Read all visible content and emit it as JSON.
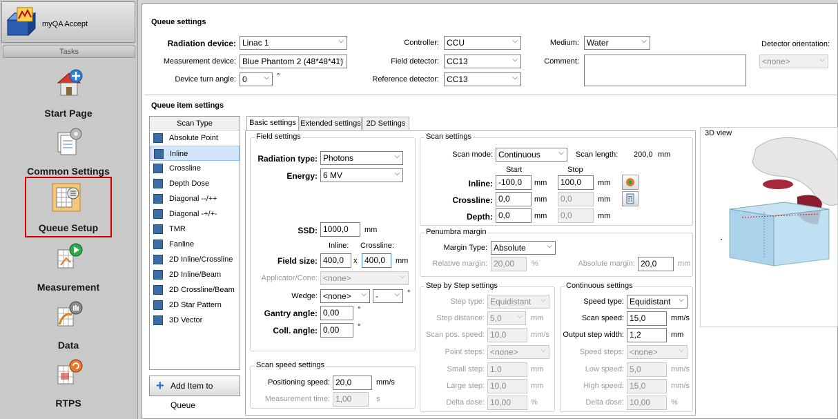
{
  "app": {
    "title": "myQA Accept",
    "tasks_label": "Tasks"
  },
  "nav": [
    {
      "label": "Start Page"
    },
    {
      "label": "Common Settings"
    },
    {
      "label": "Queue Setup"
    },
    {
      "label": "Measurement"
    },
    {
      "label": "Data"
    },
    {
      "label": "RTPS"
    }
  ],
  "queue_settings": {
    "title": "Queue settings",
    "radiation_device": {
      "label": "Radiation device:",
      "value": "Linac 1"
    },
    "measurement_device": {
      "label": "Measurement device:",
      "value": "Blue Phantom 2  (48*48*41)"
    },
    "device_turn_angle": {
      "label": "Device turn angle:",
      "value": "0",
      "unit": "°"
    },
    "controller": {
      "label": "Controller:",
      "value": "CCU"
    },
    "field_detector": {
      "label": "Field detector:",
      "value": "CC13"
    },
    "reference_detector": {
      "label": "Reference detector:",
      "value": "CC13"
    },
    "medium": {
      "label": "Medium:",
      "value": "Water"
    },
    "comment": {
      "label": "Comment:",
      "value": ""
    },
    "detector_orientation": {
      "label": "Detector orientation:",
      "value": "<none>"
    }
  },
  "queue_item": {
    "title": "Queue item settings",
    "scan_type_header": "Scan Type",
    "scan_types": [
      "Absolute Point",
      "Inline",
      "Crossline",
      "Depth Dose",
      "Diagonal --/++",
      "Diagonal -+/+-",
      "TMR",
      "Fanline",
      "2D Inline/Crossline",
      "2D Inline/Beam",
      "2D Crossline/Beam",
      "2D Star Pattern",
      "3D Vector"
    ],
    "selected_scan_type": "Inline",
    "add_button": "Add Item to Queue",
    "tabs": [
      "Basic settings",
      "Extended settings",
      "2D Settings"
    ]
  },
  "field_settings": {
    "title": "Field settings",
    "radiation_type": {
      "label": "Radiation type:",
      "value": "Photons"
    },
    "energy": {
      "label": "Energy:",
      "value": "6 MV"
    },
    "ssd": {
      "label": "SSD:",
      "value": "1000,0",
      "unit": "mm"
    },
    "field_size": {
      "label": "Field size:",
      "inline_label": "Inline:",
      "crossline_label": "Crossline:",
      "inline": "400,0",
      "x": "x",
      "crossline": "400,0",
      "unit": "mm"
    },
    "applicator": {
      "label": "Applicator/Cone:",
      "value": "<none>"
    },
    "wedge": {
      "label": "Wedge:",
      "value": "<none>",
      "angle": "-",
      "unit": "°"
    },
    "gantry_angle": {
      "label": "Gantry angle:",
      "value": "0,00",
      "unit": "°"
    },
    "coll_angle": {
      "label": "Coll. angle:",
      "value": "0,00",
      "unit": "°"
    }
  },
  "scan_speed_settings": {
    "title": "Scan speed settings",
    "positioning_speed": {
      "label": "Positioning speed:",
      "value": "20,0",
      "unit": "mm/s"
    },
    "measurement_time": {
      "label": "Measurement time:",
      "value": "1,00",
      "unit": "s"
    }
  },
  "scan_settings": {
    "title": "Scan settings",
    "scan_mode": {
      "label": "Scan mode:",
      "value": "Continuous"
    },
    "scan_length": {
      "label": "Scan length:",
      "value": "200,0",
      "unit": "mm"
    },
    "start_label": "Start",
    "stop_label": "Stop",
    "inline": {
      "label": "Inline:",
      "start": "-100,0",
      "stop": "100,0"
    },
    "crossline": {
      "label": "Crossline:",
      "start": "0,0",
      "stop": "0,0"
    },
    "depth": {
      "label": "Depth:",
      "start": "0,0",
      "stop": "0,0"
    },
    "unit": "mm"
  },
  "penumbra": {
    "title": "Penumbra margin",
    "margin_type": {
      "label": "Margin Type:",
      "value": "Absolute"
    },
    "relative_margin": {
      "label": "Relative margin:",
      "value": "20,00",
      "unit": "%"
    },
    "absolute_margin": {
      "label": "Absolute margin:",
      "value": "20,0",
      "unit": "mm"
    }
  },
  "step_settings": {
    "title": "Step by Step settings",
    "step_type": {
      "label": "Step type:",
      "value": "Equidistant"
    },
    "step_distance": {
      "label": "Step distance:",
      "value": "5,0",
      "unit": "mm"
    },
    "scan_pos_speed": {
      "label": "Scan pos. speed:",
      "value": "10,0",
      "unit": "mm/s"
    },
    "point_steps": {
      "label": "Point steps:",
      "value": "<none>"
    },
    "small_step": {
      "label": "Small step:",
      "value": "1,0",
      "unit": "mm"
    },
    "large_step": {
      "label": "Large step:",
      "value": "10,0",
      "unit": "mm"
    },
    "delta_dose": {
      "label": "Delta dose:",
      "value": "10,00",
      "unit": "%"
    }
  },
  "continuous_settings": {
    "title": "Continuous settings",
    "speed_type": {
      "label": "Speed type:",
      "value": "Equidistant"
    },
    "scan_speed": {
      "label": "Scan speed:",
      "value": "15,0",
      "unit": "mm/s"
    },
    "output_step_width": {
      "label": "Output step width:",
      "value": "1,2",
      "unit": "mm"
    },
    "speed_steps": {
      "label": "Speed steps:",
      "value": "<none>"
    },
    "low_speed": {
      "label": "Low speed:",
      "value": "5,0",
      "unit": "mm/s"
    },
    "high_speed": {
      "label": "High speed:",
      "value": "15,0",
      "unit": "mm/s"
    },
    "delta_dose": {
      "label": "Delta dose:",
      "value": "10,00",
      "unit": "%"
    }
  },
  "view3d": {
    "title": "3D view"
  }
}
